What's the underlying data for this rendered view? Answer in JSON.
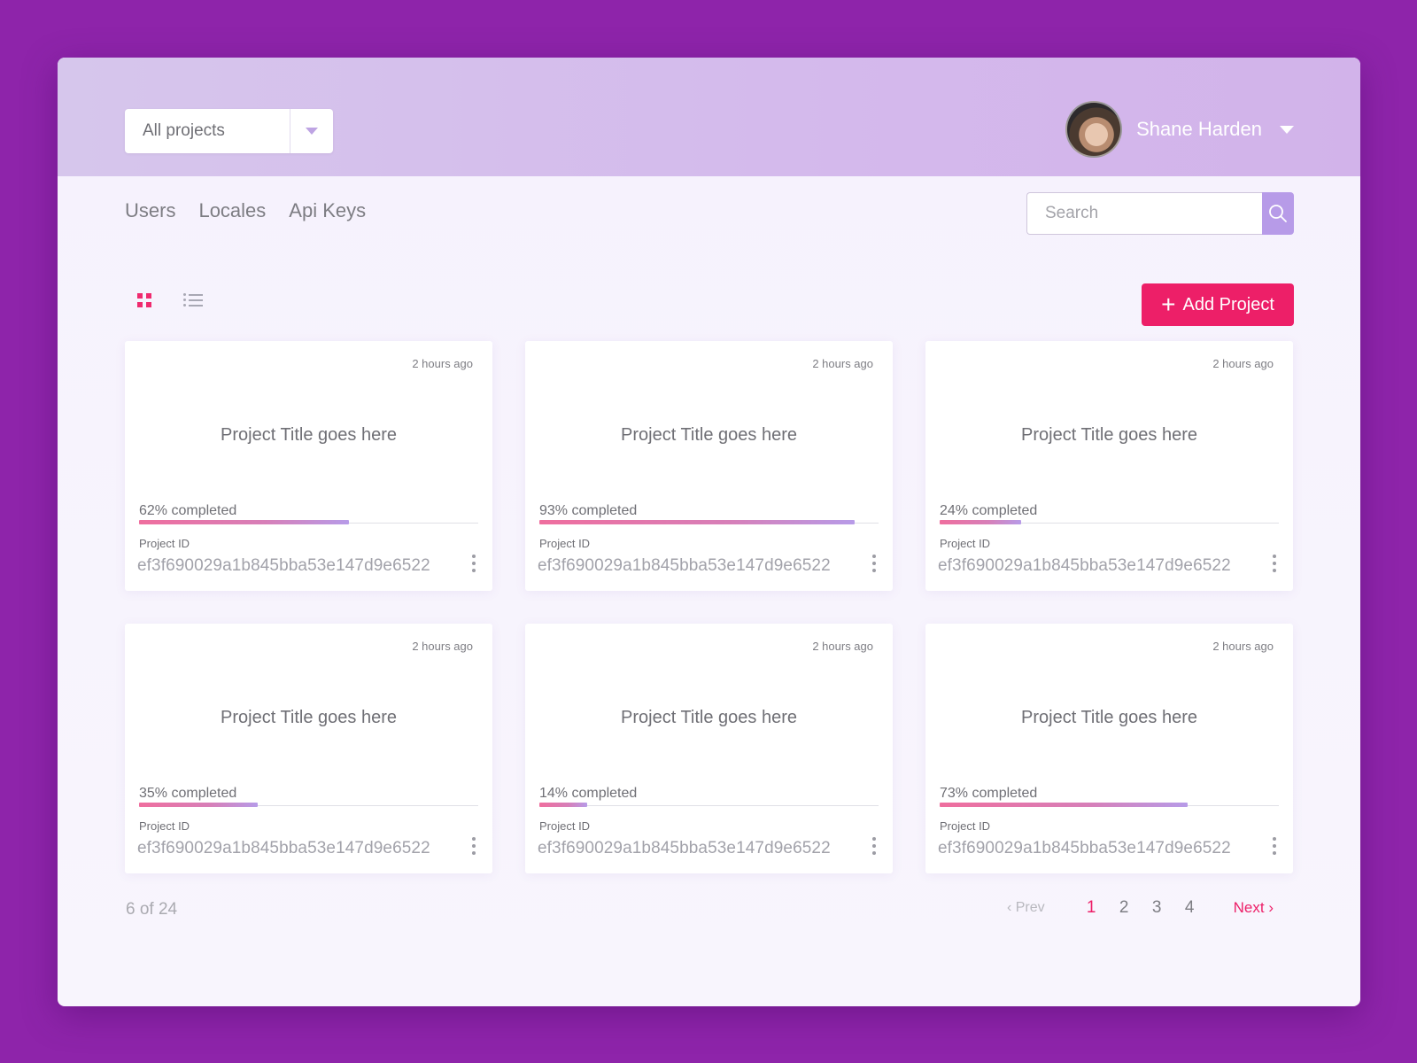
{
  "header": {
    "project_filter": {
      "selected": "All projects"
    },
    "user": {
      "name": "Shane Harden"
    }
  },
  "nav": {
    "items": [
      {
        "label": "Users"
      },
      {
        "label": "Locales"
      },
      {
        "label": "Api Keys"
      }
    ]
  },
  "search": {
    "placeholder": "Search",
    "value": ""
  },
  "toolbar": {
    "view_mode": "grid",
    "add_project_label": "Add Project"
  },
  "projects": [
    {
      "time": "2 hours ago",
      "title": "Project Title goes here",
      "progress": 62,
      "progress_label": "62% completed",
      "id_label": "Project ID",
      "id": "ef3f690029a1b845bba53e147d9e6522"
    },
    {
      "time": "2 hours ago",
      "title": "Project Title goes here",
      "progress": 93,
      "progress_label": "93% completed",
      "id_label": "Project ID",
      "id": "ef3f690029a1b845bba53e147d9e6522"
    },
    {
      "time": "2 hours ago",
      "title": "Project Title goes here",
      "progress": 24,
      "progress_label": "24% completed",
      "id_label": "Project ID",
      "id": "ef3f690029a1b845bba53e147d9e6522"
    },
    {
      "time": "2 hours ago",
      "title": "Project Title goes here",
      "progress": 35,
      "progress_label": "35% completed",
      "id_label": "Project ID",
      "id": "ef3f690029a1b845bba53e147d9e6522"
    },
    {
      "time": "2 hours ago",
      "title": "Project Title goes here",
      "progress": 14,
      "progress_label": "14% completed",
      "id_label": "Project ID",
      "id": "ef3f690029a1b845bba53e147d9e6522"
    },
    {
      "time": "2 hours ago",
      "title": "Project Title goes here",
      "progress": 73,
      "progress_label": "73% completed",
      "id_label": "Project ID",
      "id": "ef3f690029a1b845bba53e147d9e6522"
    }
  ],
  "footer": {
    "count": "6 of 24",
    "pagination": {
      "prev_label": "‹ Prev",
      "pages": [
        "1",
        "2",
        "3",
        "4"
      ],
      "current": "1",
      "next_label": "Next ›"
    }
  },
  "colors": {
    "background": "#8e24aa",
    "accent": "#ed1f68",
    "search_button": "#b79be8"
  }
}
